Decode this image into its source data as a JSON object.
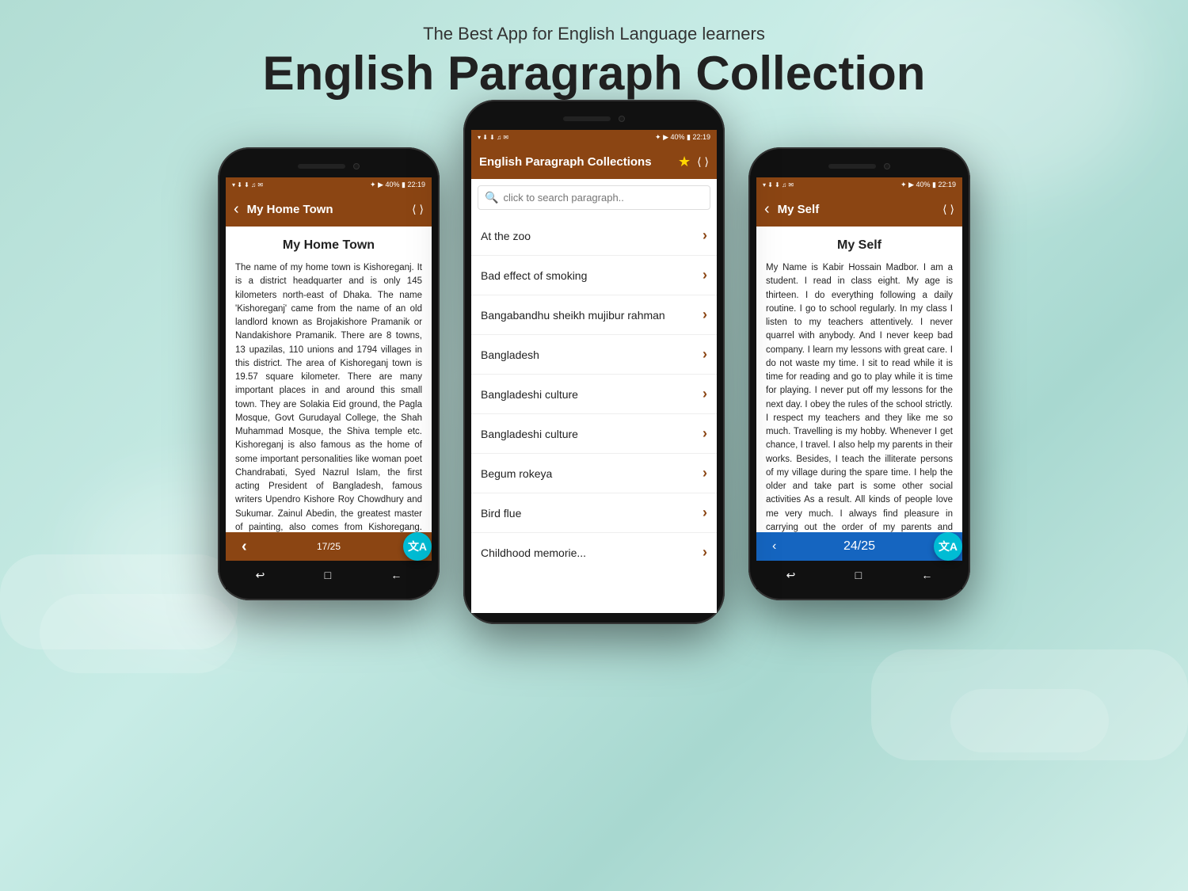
{
  "background": {
    "color_start": "#b2ddd4",
    "color_end": "#a8d8d0"
  },
  "header": {
    "subtitle": "The Best App for English Language learners",
    "title": "English Paragraph Collection"
  },
  "left_phone": {
    "status": {
      "time": "22:19",
      "battery": "40%"
    },
    "app_header": {
      "back_label": "‹",
      "title": "My Home Town",
      "share_icon": "⋮"
    },
    "article": {
      "heading": "My Home Town",
      "body": "The name of my home town is Kishoreganj. It is a district headquarter and is only 145 kilometers north-east of Dhaka. The name 'Kishoreganj' came from the name of an old landlord known as Brojakishore Pramanik or Nandakishore Pramanik. There are 8 towns, 13 upazilas, 110 unions and 1794 villages in this district. The area of Kishoreganj town is 19.57 square kilometer. There are many important places in and around this small town. They are Solakia Eid ground, the Pagla Mosque, Govt Gurudayal College, the Shah Muhammad Mosque, the Shiva temple etc. Kishoreganj is also famous as the home of some important personalities like woman poet Chandrabati, Syed Nazrul Islam, the first acting President of Bangladesh, famous writers Upendro Kishore Roy Chowdhury and Sukumar. Zainul Abedin, the greatest master of painting, also comes from Kishoregang. Really, I am very proud of my home town."
    },
    "bottom_bar": {
      "page": "17/25",
      "left_arrow": "‹",
      "right_arrow": "›"
    },
    "translate_label": "文A",
    "android_nav": [
      "↩",
      "□",
      "←"
    ]
  },
  "center_phone": {
    "status": {
      "time": "22:19",
      "battery": "40%"
    },
    "app_header": {
      "title": "English Paragraph Collections",
      "star_icon": "★",
      "share_icon": "⋮"
    },
    "search": {
      "placeholder": "click to search paragraph..",
      "icon": "🔍"
    },
    "list_items": [
      {
        "label": "At the zoo",
        "chevron": "›"
      },
      {
        "label": "Bad effect of smoking",
        "chevron": "›"
      },
      {
        "label": "Bangabandhu sheikh mujibur rahman",
        "chevron": "›"
      },
      {
        "label": "Bangladesh",
        "chevron": "›"
      },
      {
        "label": "Bangladeshi culture",
        "chevron": "›"
      },
      {
        "label": "Bangladeshi culture",
        "chevron": "›"
      },
      {
        "label": "Begum rokeya",
        "chevron": "›"
      },
      {
        "label": "Bird flue",
        "chevron": "›"
      },
      {
        "label": "Childhood memorie...",
        "chevron": "›"
      }
    ]
  },
  "right_phone": {
    "status": {
      "time": "22:19",
      "battery": "40%"
    },
    "app_header": {
      "back_label": "‹",
      "title": "My Self",
      "share_icon": "⋮"
    },
    "article": {
      "heading": "My Self",
      "body": "My Name is Kabir Hossain Madbor. I am a student. I read in class eight. My age is thirteen. I do everything following a daily routine. I go to school regularly. In my class I listen to my teachers attentively. I never quarrel with anybody. And I never keep bad company. I learn my lessons with great care. I do not waste my time. I sit to read while it is time for reading and go to play while it is time for playing. I never put off my lessons for the next day. I obey the rules of the school strictly. I respect my teachers and they like me so much. Travelling is my hobby. Whenever I get chance, I travel. I also help my parents in their works. Besides, I teach the illiterate persons of my village during the spare time. I help the older and take part is some other social activities As a result. All kinds of people love me very much. I always find pleasure in carrying out the order of my parents and teachers."
    },
    "bottom_bar": {
      "page": "24/25",
      "left_arrow": "‹",
      "right_arrow": "›",
      "bg_color": "#1565C0"
    },
    "translate_label": "文A",
    "android_nav": [
      "↩",
      "□",
      "←"
    ]
  }
}
